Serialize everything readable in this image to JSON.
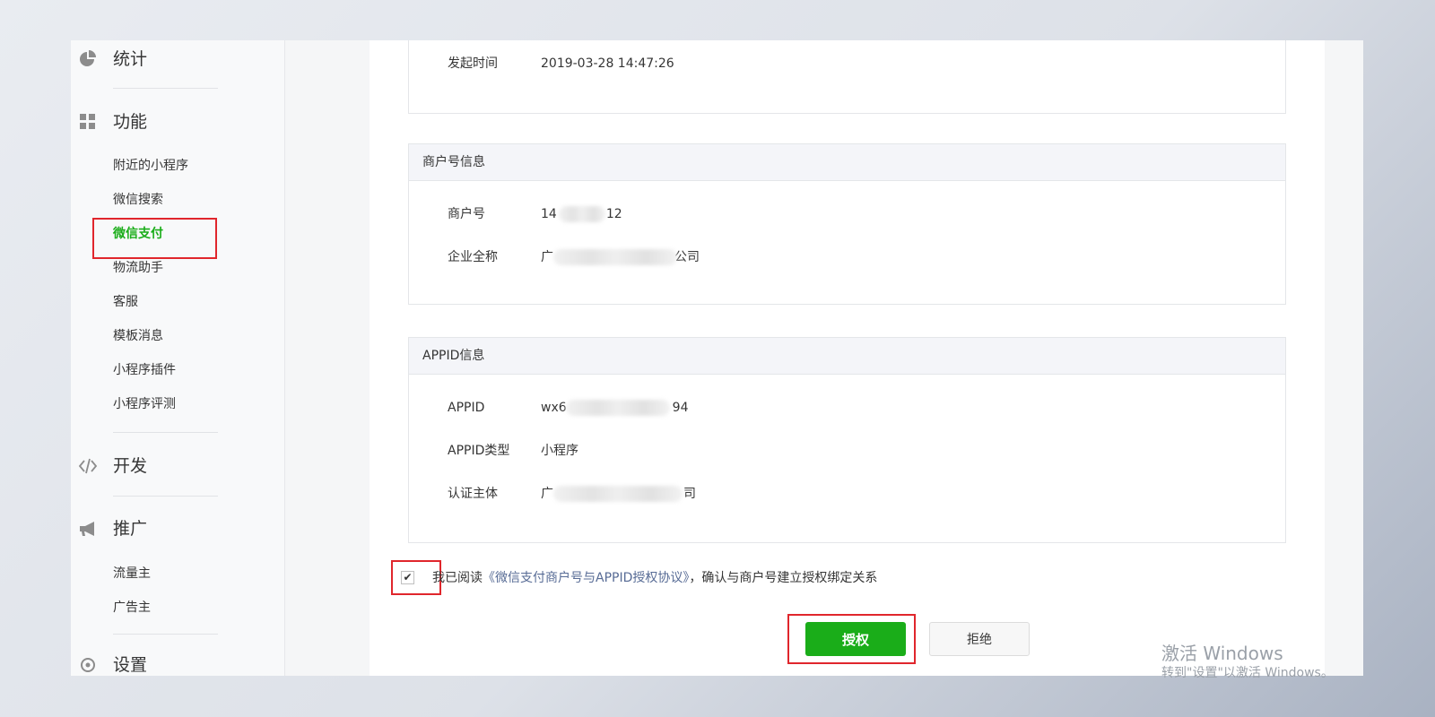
{
  "sidebar": {
    "sections": {
      "stats": {
        "title": "统计",
        "icon": "pie-chart-icon"
      },
      "features": {
        "title": "功能",
        "icon": "grid-icon",
        "items": [
          "附近的小程序",
          "微信搜索",
          "微信支付",
          "物流助手",
          "客服",
          "模板消息",
          "小程序插件",
          "小程序评测"
        ],
        "active_item": "微信支付"
      },
      "develop": {
        "title": "开发",
        "icon": "code-icon"
      },
      "promote": {
        "title": "推广",
        "icon": "megaphone-icon",
        "items": [
          "流量主",
          "广告主"
        ]
      },
      "settings": {
        "title": "设置",
        "icon": "gear-icon"
      }
    }
  },
  "main": {
    "initiate": {
      "label": "发起时间",
      "value": "2019-03-28 14:47:26"
    },
    "merchant": {
      "header": "商户号信息",
      "rows": [
        {
          "label": "商户号",
          "value_prefix": "14",
          "value_suffix": "12"
        },
        {
          "label": "企业全称",
          "value_prefix": "广",
          "value_suffix": "公司"
        }
      ]
    },
    "appid": {
      "header": "APPID信息",
      "rows": [
        {
          "label": "APPID",
          "value_prefix": "wx6",
          "value_suffix": "94"
        },
        {
          "label": "APPID类型",
          "value": "小程序"
        },
        {
          "label": "认证主体",
          "value_prefix": "广",
          "value_suffix": "司"
        }
      ]
    },
    "agreement": {
      "prefix": "我已阅读",
      "link": "《微信支付商户号与APPID授权协议》",
      "suffix": "，确认与商户号建立授权绑定关系",
      "checked": true,
      "check_glyph": "✔"
    },
    "buttons": {
      "authorize": "授权",
      "reject": "拒绝"
    }
  },
  "watermark": {
    "line1": "激活 Windows",
    "line2": "转到\"设置\"以激活 Windows。"
  },
  "colors": {
    "accent": "#1aad19",
    "link": "#576b95",
    "highlight": "#e0262c"
  }
}
